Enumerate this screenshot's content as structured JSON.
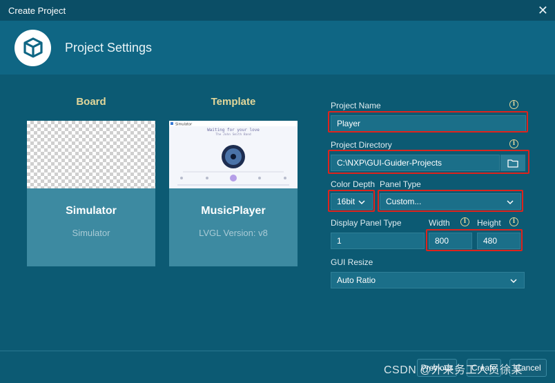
{
  "window": {
    "title": "Create Project"
  },
  "header": {
    "title": "Project Settings"
  },
  "board": {
    "label": "Board",
    "card": {
      "name": "Simulator",
      "sub": "Simulator"
    }
  },
  "template": {
    "label": "Template",
    "card": {
      "name": "MusicPlayer",
      "sub": "LVGL Version: v8",
      "preview": {
        "window_title": "Simulator",
        "song": "Waiting for your love",
        "artist": "The John Smith Band"
      }
    }
  },
  "form": {
    "project_name_label": "Project Name",
    "project_name_value": "Player",
    "project_directory_label": "Project Directory",
    "project_directory_value": "C:\\NXP\\GUI-Guider-Projects",
    "color_depth_label": "Color Depth",
    "color_depth_value": "16bit",
    "panel_type_label": "Panel Type",
    "panel_type_value": "Custom...",
    "display_panel_type_label": "Display Panel Type",
    "display_panel_type_value": "1",
    "width_label": "Width",
    "width_value": "800",
    "height_label": "Height",
    "height_value": "480",
    "gui_resize_label": "GUI Resize",
    "gui_resize_value": "Auto Ratio",
    "info_glyph": "i"
  },
  "footer": {
    "previous_label": "Previous",
    "create_label": "Create",
    "cancel_label": "Cancel",
    "watermark": "CSDN @外来务工人员徐某"
  },
  "colors": {
    "background": "#0c5a73",
    "header": "#0f6684",
    "card": "#3d8aa1",
    "accent_gold": "#e3d79a",
    "highlight_red": "#e0231c"
  },
  "icons": [
    "cube-logo-icon",
    "close-icon",
    "info-icon",
    "folder-icon",
    "chevron-down-icon"
  ]
}
